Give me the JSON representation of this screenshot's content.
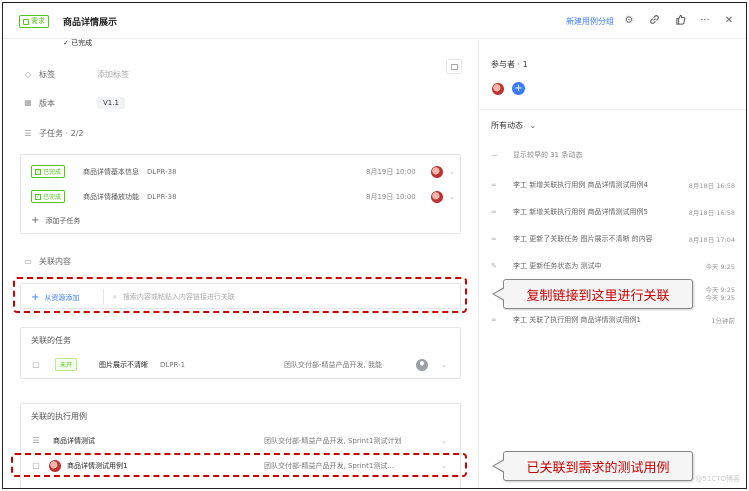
{
  "header": {
    "badge": "需求",
    "title": "商品详情展示",
    "link": "新建用例分组",
    "icons": [
      "gear-icon",
      "link-icon",
      "thumbs-up-icon",
      "more-icon",
      "close-icon"
    ]
  },
  "fields": {
    "top_cut": "✓ 已完成",
    "tag_label": "标签",
    "tag_value": "添加标签",
    "version_label": "版本",
    "version_value": "V1.1",
    "subtask_label": "子任务 · 2/2"
  },
  "subtasks": [
    {
      "status": "已完成",
      "name": "商品详情基本信息",
      "id": "DLPR-38",
      "date": "8月19日 10:00"
    },
    {
      "status": "已完成",
      "name": "商品详情播放功能",
      "id": "DLPR-38",
      "date": "8月19日 10:00"
    }
  ],
  "add_subtask": "添加子任务",
  "relation": {
    "label": "关联内容",
    "add_button": "从资源添加",
    "search_placeholder": "搜索内容或粘贴入内容链接进行关联"
  },
  "related_tasks": {
    "title": "关联的任务",
    "items": [
      {
        "status": "未开",
        "name": "图片展示不清晰",
        "id": "DLPR-1",
        "project": "团队交付部-精益产品开发, 我能"
      }
    ]
  },
  "related_cases": {
    "title": "关联的执行用例",
    "items": [
      {
        "name": "商品详情测试",
        "project": "团队交付部-精益产品开发, Sprint1测试计划"
      },
      {
        "name": "商品详情测试用例1",
        "project": "团队交付部-精益产品开发, Sprint1测试..."
      }
    ]
  },
  "annotations": {
    "paste_hint": "复制链接到这里进行关联",
    "linked_hint": "已关联到需求的测试用例"
  },
  "right": {
    "participants": "参与者 · 1",
    "activity_filter": "所有动态",
    "show_older": "显示较早的 31 条动态",
    "activities": [
      {
        "text": "李工 新增关联执行用例 商品详情测试用例4",
        "time": "8月18日 16:58"
      },
      {
        "text": "李工 新增关联执行用例 商品详情测试用例5",
        "time": "8月18日 16:58"
      },
      {
        "text": "李工 更新了关联任务 图片展示不清晰 的内容",
        "time": "8月18日 17:04"
      },
      {
        "text": "李工 更新任务状态为 测试中",
        "time": "今天 9:25"
      },
      {
        "text": "",
        "time": "今天 9:25"
      },
      {
        "text": "",
        "time": "今天 9:25"
      },
      {
        "text": "李工 关联了执行用例 商品详情测试用例1",
        "time": "1分钟前"
      }
    ]
  },
  "watermark": "@51CTO博客"
}
